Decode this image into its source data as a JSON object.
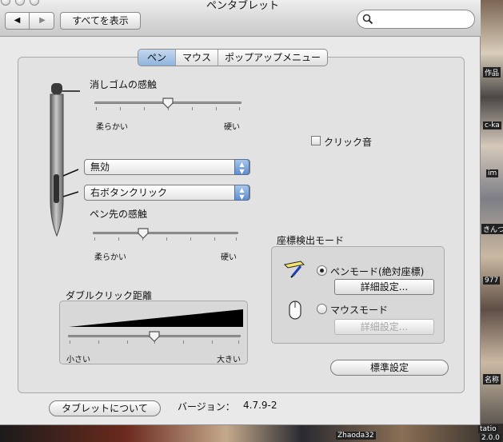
{
  "window": {
    "title": "ペンタブレット"
  },
  "toolbar": {
    "show_all_label": "すべてを表示",
    "search_placeholder": ""
  },
  "tabs": [
    {
      "label": "ペン",
      "selected": true
    },
    {
      "label": "マウス",
      "selected": false
    },
    {
      "label": "ポップアップメニュー",
      "selected": false
    }
  ],
  "eraser": {
    "title": "消しゴムの感触",
    "min_label": "柔らかい",
    "max_label": "硬い",
    "value_fraction": 0.5
  },
  "side_switch": {
    "upper_value": "無効",
    "lower_value": "右ボタンクリック"
  },
  "tip": {
    "title": "ペン先の感触",
    "min_label": "柔らかい",
    "max_label": "硬い",
    "value_fraction": 0.35
  },
  "click_sound": {
    "label": "クリック音",
    "checked": false
  },
  "double_click": {
    "title": "ダブルクリック距離",
    "min_label": "小さい",
    "max_label": "大きい",
    "value_fraction": 0.5
  },
  "tracking": {
    "title": "座標検出モード",
    "pen_mode_label": "ペンモード(絶対座標)",
    "mouse_mode_label": "マウスモード",
    "details_label": "詳細設定...",
    "selected": "pen"
  },
  "default_button": "標準設定",
  "about_button": "タブレットについて",
  "version": {
    "label": "バージョン：",
    "value": "4.7.9-2"
  },
  "desktop_labels": {
    "right_1": "作品",
    "right_2": "c-ka",
    "right_3": "im",
    "right_4": "きんつ",
    "right_5": "977",
    "right_6": "名称",
    "bottom_1": "Zhaoda32",
    "bottom_2": "tatio",
    "bottom_3": "2.0.0"
  }
}
